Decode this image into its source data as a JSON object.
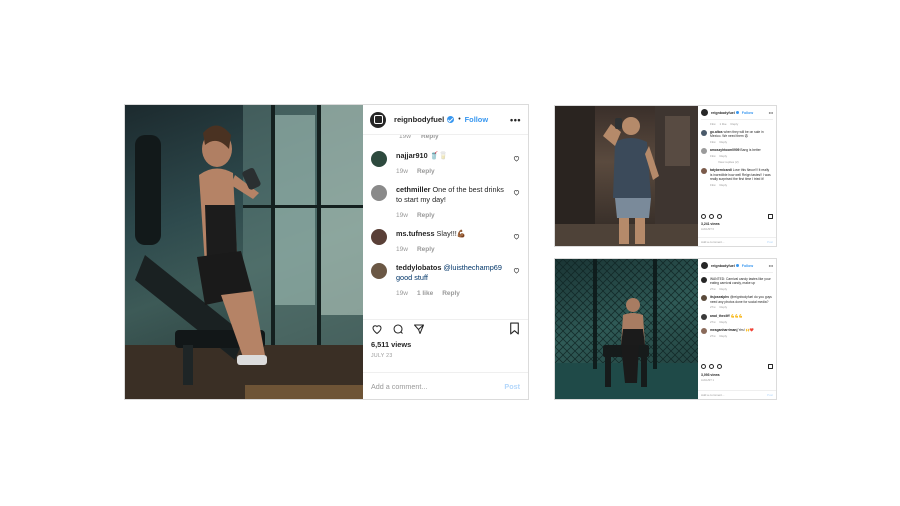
{
  "big_post": {
    "username": "reignbodyfuel",
    "follow_label": "Follow",
    "separator": "•",
    "more_label": "•••",
    "clipped_time": "19w",
    "clipped_reply": "Reply",
    "comments": [
      {
        "user": "najjar910",
        "text": "🥤🥛",
        "time": "19w",
        "likes": "",
        "reply": "Reply",
        "avatar_color": "#2d4a3e"
      },
      {
        "user": "cethmiller",
        "text": "One of the best drinks to start my day!",
        "time": "19w",
        "likes": "",
        "reply": "Reply",
        "avatar_color": "#8a8a8a"
      },
      {
        "user": "ms.tufness",
        "text": "Slay!!!💪🏾",
        "time": "19w",
        "likes": "",
        "reply": "Reply",
        "avatar_color": "#5a4038"
      },
      {
        "user": "teddylobatos",
        "text": "@luisthechamp69 good stuff",
        "time": "19w",
        "likes": "1 like",
        "reply": "Reply",
        "avatar_color": "#6b5845"
      }
    ],
    "views": "6,511 views",
    "date": "JULY 23",
    "add_comment_placeholder": "Add a comment...",
    "post_label": "Post"
  },
  "small_post_1": {
    "username": "reignbodyfuel",
    "follow_label": "Follow",
    "more_label": "•••",
    "top_meta": [
      "19w",
      "1 like",
      "Reply"
    ],
    "comments": [
      {
        "user": "go.altos",
        "text": "when they will be on sale in Mexico. We need them 😩",
        "time": "19w",
        "reply": "Reply",
        "avatar_color": "#4a5a6a"
      },
      {
        "user": "amoszyhtoom0909",
        "text": "Bang is better",
        "time": "19w",
        "reply": "Reply",
        "avatar_color": "#9a9a9a",
        "view_replies": "View replies (2)"
      },
      {
        "user": "tatybernicardi",
        "text": "Love this flavor!!! It really is incredible how well Reign tastes!! I was really surprised the first time I tried it!",
        "time": "19w",
        "reply": "Reply",
        "avatar_color": "#7a5a4a"
      }
    ],
    "views": "3,241 views",
    "date": "AUGUST 6",
    "add_comment": "Add a comment...",
    "post_label": "Post"
  },
  "small_post_2": {
    "username": "reignbodyfuel",
    "follow_label": "Follow",
    "more_label": "•••",
    "comments": [
      {
        "user": "reignbodyfuel",
        "text": "WANTED: Carnival candy tastes like your eating carnival candy, make up",
        "time": "27w",
        "reply": "Reply",
        "avatar_color": "#262626"
      },
      {
        "user": "itsjosealphv",
        "text": "@reignbodyfuel do you guys need any photos done for social media?",
        "time": "27w",
        "reply": "Reply",
        "avatar_color": "#5a4a3a"
      },
      {
        "user": "arad_thecliff",
        "text": "💪💪💪",
        "time": "27w",
        "reply": "Reply",
        "avatar_color": "#3a3a3a"
      },
      {
        "user": "meaganharrimanj",
        "text": "Yes! 🙌❤️",
        "time": "27w",
        "reply": "Reply",
        "avatar_color": "#8a6a5a"
      }
    ],
    "views": "3,093 views",
    "date": "AUGUST 1",
    "add_comment": "Add a comment...",
    "post_label": "Post"
  }
}
